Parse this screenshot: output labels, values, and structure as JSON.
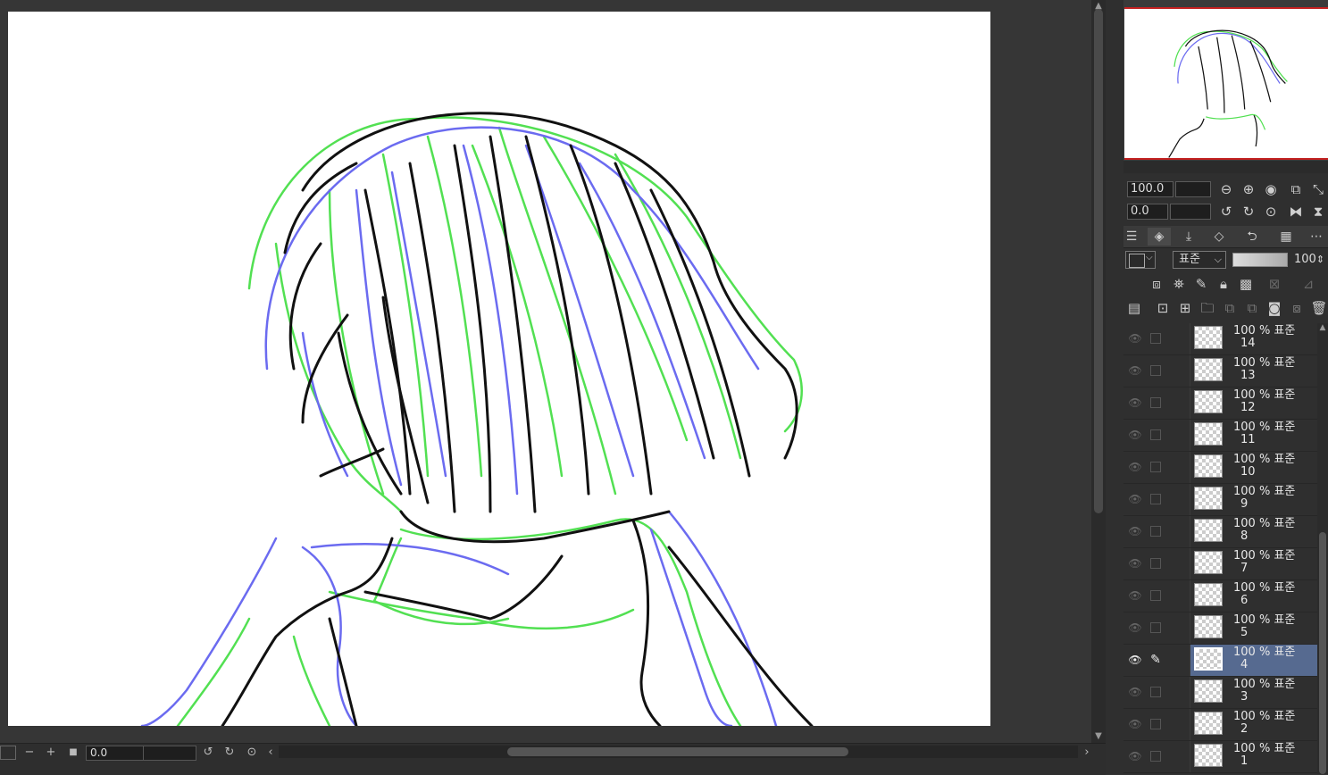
{
  "canvas": {
    "colors": {
      "black": "#111111",
      "blue": "#6b6bf0",
      "green": "#52e052"
    }
  },
  "status_bar": {
    "angle_value": "0.0",
    "minus_label": "−",
    "plus_label": "+",
    "stop_label": "■",
    "scroll_left_label": "‹",
    "scroll_right_label": "›"
  },
  "navigator": {
    "zoom_value": "100.0",
    "rotation_value": "0.0"
  },
  "layer_panel": {
    "blend_mode": "표준",
    "opacity": "100",
    "selected_index": 10,
    "layers": [
      {
        "meta": "100 % 표준",
        "name": "14"
      },
      {
        "meta": "100 % 표준",
        "name": "13"
      },
      {
        "meta": "100 % 표준",
        "name": "12"
      },
      {
        "meta": "100 % 표준",
        "name": "11"
      },
      {
        "meta": "100 % 표준",
        "name": "10"
      },
      {
        "meta": "100 % 표준",
        "name": "9"
      },
      {
        "meta": "100 % 표준",
        "name": "8"
      },
      {
        "meta": "100 % 표준",
        "name": "7"
      },
      {
        "meta": "100 % 표준",
        "name": "6"
      },
      {
        "meta": "100 % 표준",
        "name": "5"
      },
      {
        "meta": "100 % 표준",
        "name": "4"
      },
      {
        "meta": "100 % 표준",
        "name": "3"
      },
      {
        "meta": "100 % 표준",
        "name": "2"
      },
      {
        "meta": "100 % 표준",
        "name": "1"
      }
    ]
  }
}
